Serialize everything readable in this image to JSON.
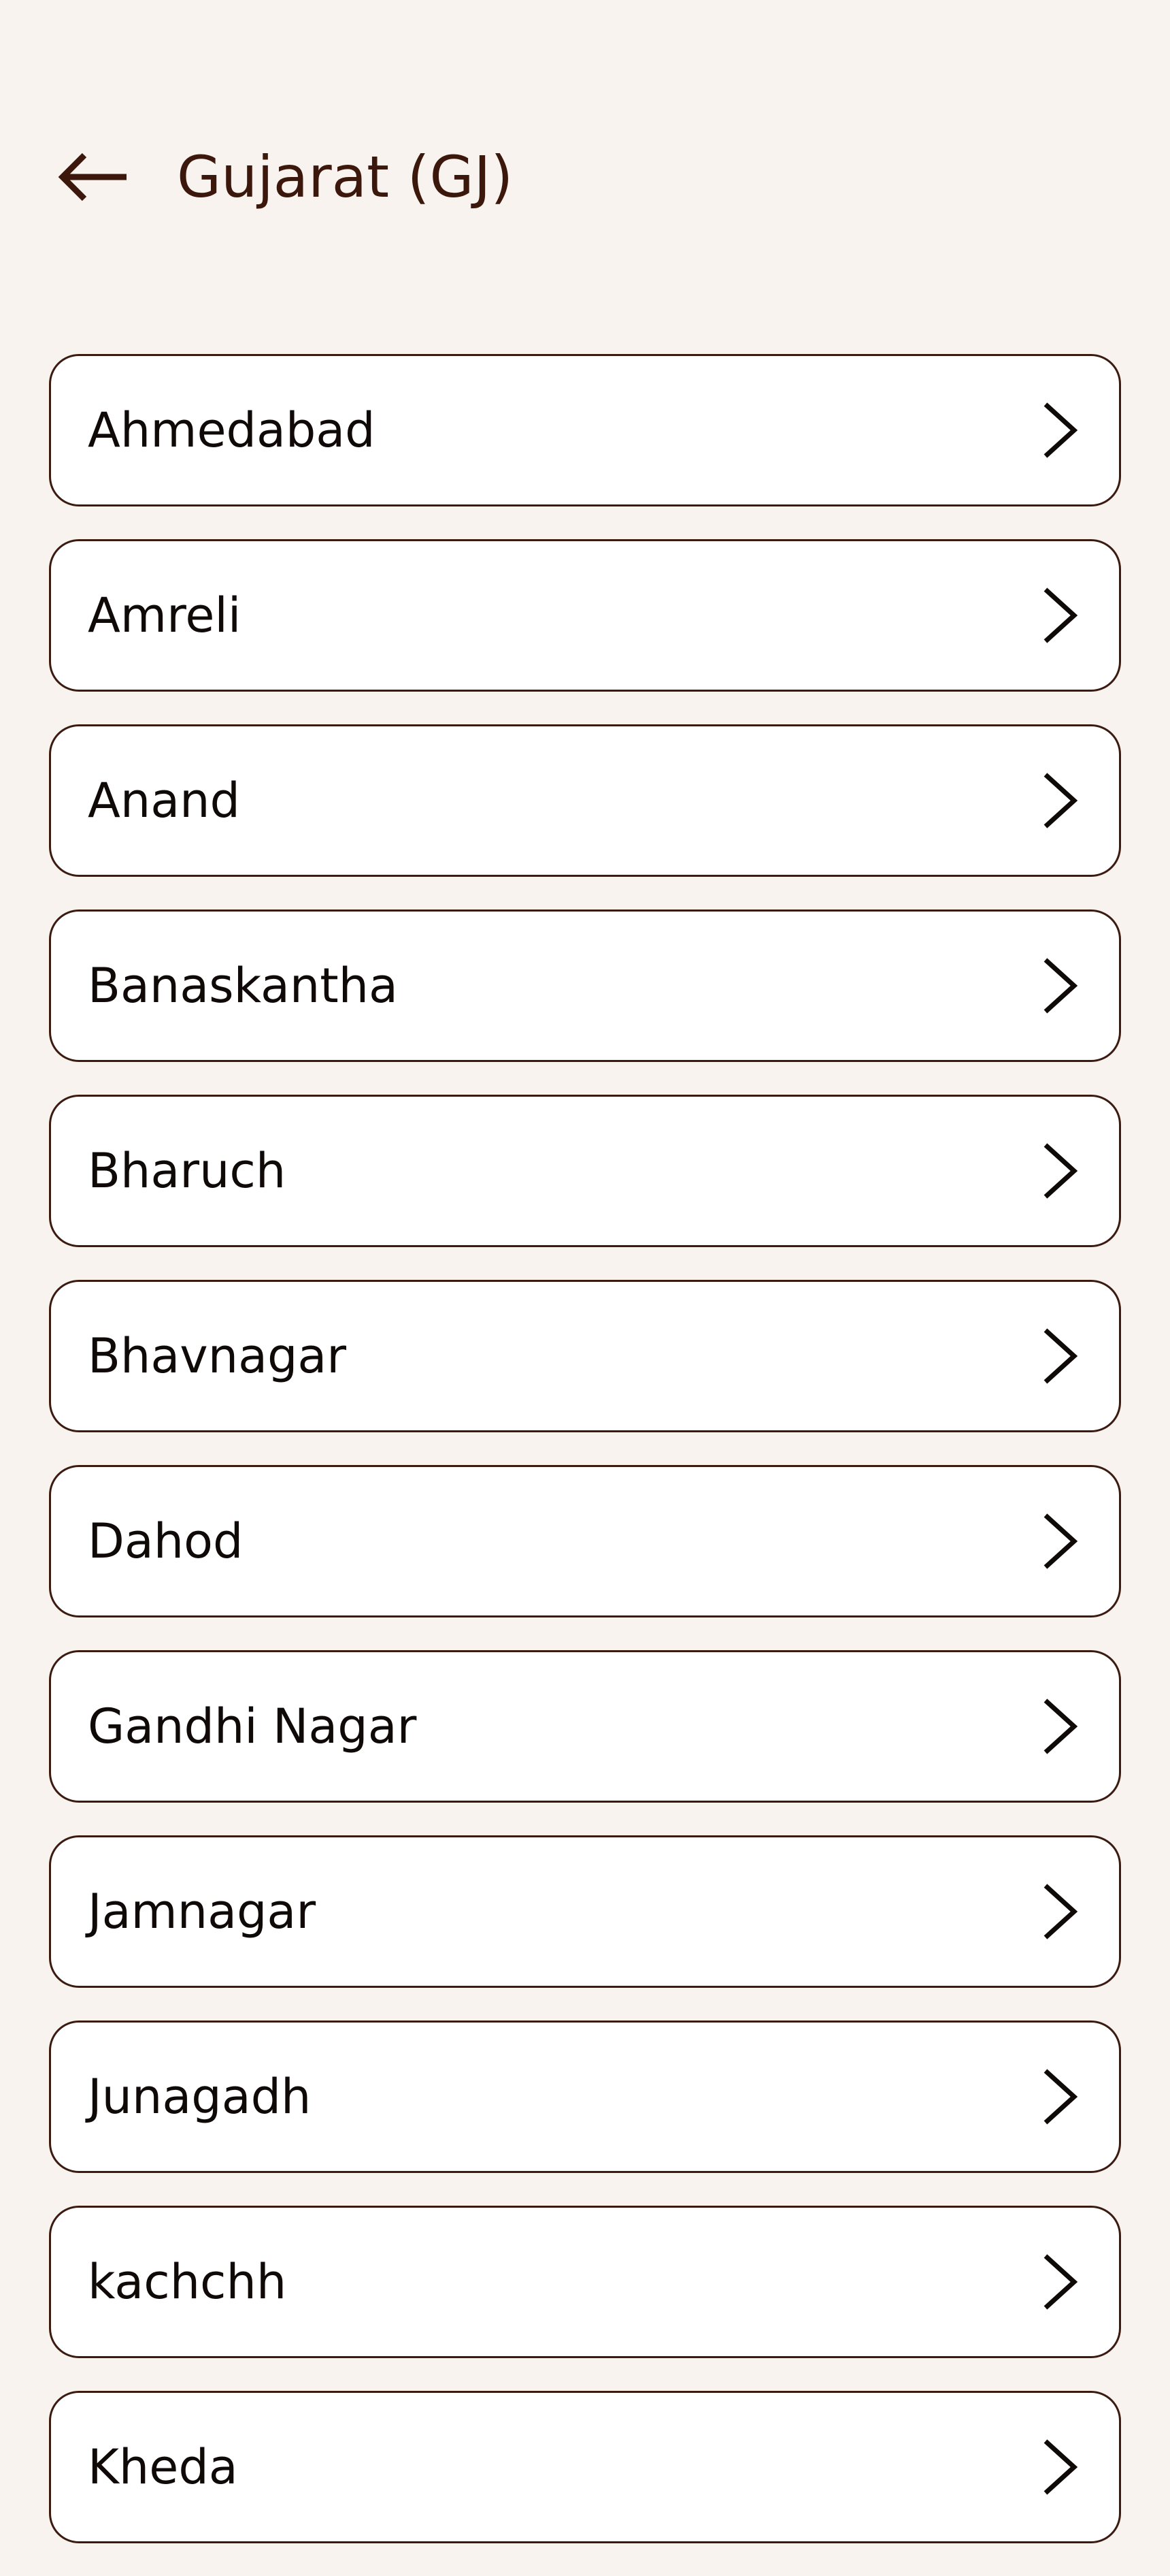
{
  "header": {
    "title": "Gujarat (GJ)",
    "back_icon": "arrow-left-icon"
  },
  "districts": [
    {
      "label": "Ahmedabad"
    },
    {
      "label": "Amreli"
    },
    {
      "label": "Anand"
    },
    {
      "label": "Banaskantha"
    },
    {
      "label": "Bharuch"
    },
    {
      "label": "Bhavnagar"
    },
    {
      "label": "Dahod"
    },
    {
      "label": "Gandhi Nagar"
    },
    {
      "label": "Jamnagar"
    },
    {
      "label": "Junagadh"
    },
    {
      "label": "kachchh"
    },
    {
      "label": "Kheda"
    }
  ],
  "icons": {
    "row_chevron": "chevron-right-icon"
  },
  "colors": {
    "background": "#f9f3ef",
    "title": "#3b180b",
    "card_border": "#3b1a0f",
    "card_background": "#ffffff",
    "text": "#0f0a08"
  }
}
